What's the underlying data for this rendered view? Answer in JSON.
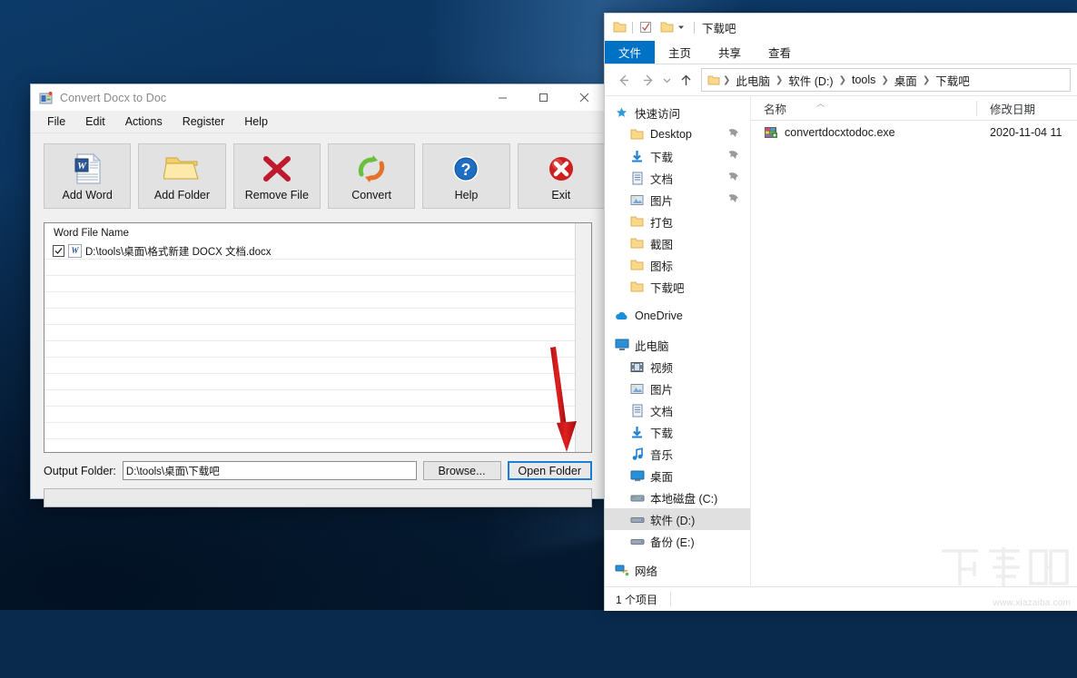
{
  "desktop": {
    "wallpaper": "windows-10-blue-hero"
  },
  "app": {
    "title": "Convert Docx to Doc",
    "icon": "app-icon",
    "caption": {
      "minimize": "minimize-icon",
      "maximize": "maximize-icon",
      "close": "close-icon"
    },
    "menu": [
      "File",
      "Edit",
      "Actions",
      "Register",
      "Help"
    ],
    "toolbar": [
      {
        "label": "Add Word",
        "icon": "word-document-icon"
      },
      {
        "label": "Add Folder",
        "icon": "folder-icon"
      },
      {
        "label": "Remove File",
        "icon": "red-x-icon"
      },
      {
        "label": "Convert",
        "icon": "convert-arrows-icon"
      },
      {
        "label": "Help",
        "icon": "blue-question-icon"
      },
      {
        "label": "Exit",
        "icon": "red-circle-x-icon"
      }
    ],
    "list": {
      "header": "Word File Name",
      "rows": [
        {
          "checked": true,
          "icon": "word-icon",
          "path": "D:\\tools\\桌面\\格式新建 DOCX 文档.docx"
        }
      ]
    },
    "output": {
      "label": "Output Folder:",
      "value": "D:\\tools\\桌面\\下载吧",
      "placeholder": "",
      "browse_label": "Browse...",
      "open_folder_label": "Open Folder"
    },
    "annotation": {
      "type": "red-arrow",
      "points_to": "Open Folder"
    }
  },
  "explorer": {
    "title": "下载吧",
    "quick_icons": [
      "folder-icon",
      "properties-icon",
      "new-folder-icon",
      "customize-dropdown-icon"
    ],
    "ribbon_tabs": [
      {
        "label": "文件",
        "active": true
      },
      {
        "label": "主页",
        "active": false
      },
      {
        "label": "共享",
        "active": false
      },
      {
        "label": "查看",
        "active": false
      }
    ],
    "nav_buttons": {
      "back": "back-arrow-icon",
      "forward": "forward-arrow-icon",
      "recent": "chevron-down-icon",
      "up": "up-arrow-icon"
    },
    "breadcrumb": [
      "此电脑",
      "软件 (D:)",
      "tools",
      "桌面",
      "下载吧"
    ],
    "sidebar": [
      {
        "label": "快速访问",
        "icon": "star-icon",
        "level": 1,
        "pin": false,
        "selected": false
      },
      {
        "label": "Desktop",
        "icon": "folder-icon",
        "level": 2,
        "pin": true,
        "selected": false
      },
      {
        "label": "下载",
        "icon": "download-icon",
        "level": 2,
        "pin": true,
        "selected": false
      },
      {
        "label": "文档",
        "icon": "documents-icon",
        "level": 2,
        "pin": true,
        "selected": false
      },
      {
        "label": "图片",
        "icon": "pictures-icon",
        "level": 2,
        "pin": true,
        "selected": false
      },
      {
        "label": "打包",
        "icon": "folder-icon",
        "level": 2,
        "pin": false,
        "selected": false
      },
      {
        "label": "截图",
        "icon": "folder-icon",
        "level": 2,
        "pin": false,
        "selected": false
      },
      {
        "label": "图标",
        "icon": "folder-icon",
        "level": 2,
        "pin": false,
        "selected": false
      },
      {
        "label": "下载吧",
        "icon": "folder-icon",
        "level": 2,
        "pin": false,
        "selected": false
      },
      {
        "label": "OneDrive",
        "icon": "onedrive-icon",
        "level": 1,
        "pin": false,
        "selected": false
      },
      {
        "label": "此电脑",
        "icon": "this-pc-icon",
        "level": 1,
        "pin": false,
        "selected": false
      },
      {
        "label": "视频",
        "icon": "videos-icon",
        "level": 2,
        "pin": false,
        "selected": false
      },
      {
        "label": "图片",
        "icon": "pictures-icon",
        "level": 2,
        "pin": false,
        "selected": false
      },
      {
        "label": "文档",
        "icon": "documents-icon",
        "level": 2,
        "pin": false,
        "selected": false
      },
      {
        "label": "下载",
        "icon": "download-icon",
        "level": 2,
        "pin": false,
        "selected": false
      },
      {
        "label": "音乐",
        "icon": "music-icon",
        "level": 2,
        "pin": false,
        "selected": false
      },
      {
        "label": "桌面",
        "icon": "desktop-icon",
        "level": 2,
        "pin": false,
        "selected": false
      },
      {
        "label": "本地磁盘 (C:)",
        "icon": "system-drive-icon",
        "level": 2,
        "pin": false,
        "selected": false
      },
      {
        "label": "软件 (D:)",
        "icon": "drive-icon",
        "level": 2,
        "pin": false,
        "selected": true
      },
      {
        "label": "备份 (E:)",
        "icon": "drive-icon",
        "level": 2,
        "pin": false,
        "selected": false
      },
      {
        "label": "网络",
        "icon": "network-icon",
        "level": 1,
        "pin": false,
        "selected": false
      }
    ],
    "columns": [
      "名称",
      "修改日期"
    ],
    "files": [
      {
        "name": "convertdocxtodoc.exe",
        "icon": "exe-icon",
        "modified": "2020-11-04 11"
      }
    ],
    "status": "1 个项目"
  },
  "watermark": {
    "text": "下载吧",
    "url": "www.xiazaiba.com"
  }
}
